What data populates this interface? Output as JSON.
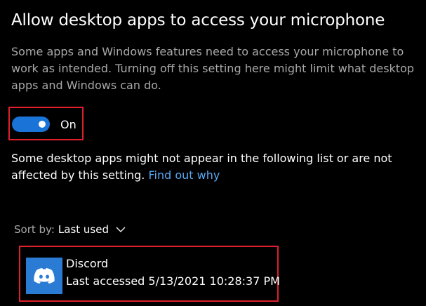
{
  "header": {
    "title": "Allow desktop apps to access your microphone"
  },
  "description": "Some apps and Windows features need to access your microphone to work as intended. Turning off this setting here might limit what desktop apps and Windows can do.",
  "toggle": {
    "state_label": "On",
    "is_on": true,
    "accent_color": "#1a73d6"
  },
  "note": {
    "text": "Some desktop apps might not appear in the following list or are not affected by this setting.",
    "link_text": "Find out why"
  },
  "sort": {
    "label": "Sort by:",
    "value": "Last used",
    "icon": "chevron-down-icon"
  },
  "apps": [
    {
      "name": "Discord",
      "last_accessed": "Last accessed 5/13/2021 10:28:37 PM",
      "icon": "discord-icon",
      "icon_bg": "#2a7bd3"
    }
  ],
  "colors": {
    "background": "#000000",
    "secondary_text": "#a8a8a8",
    "link": "#5aa8f0",
    "highlight_box": "#e01f2a"
  }
}
